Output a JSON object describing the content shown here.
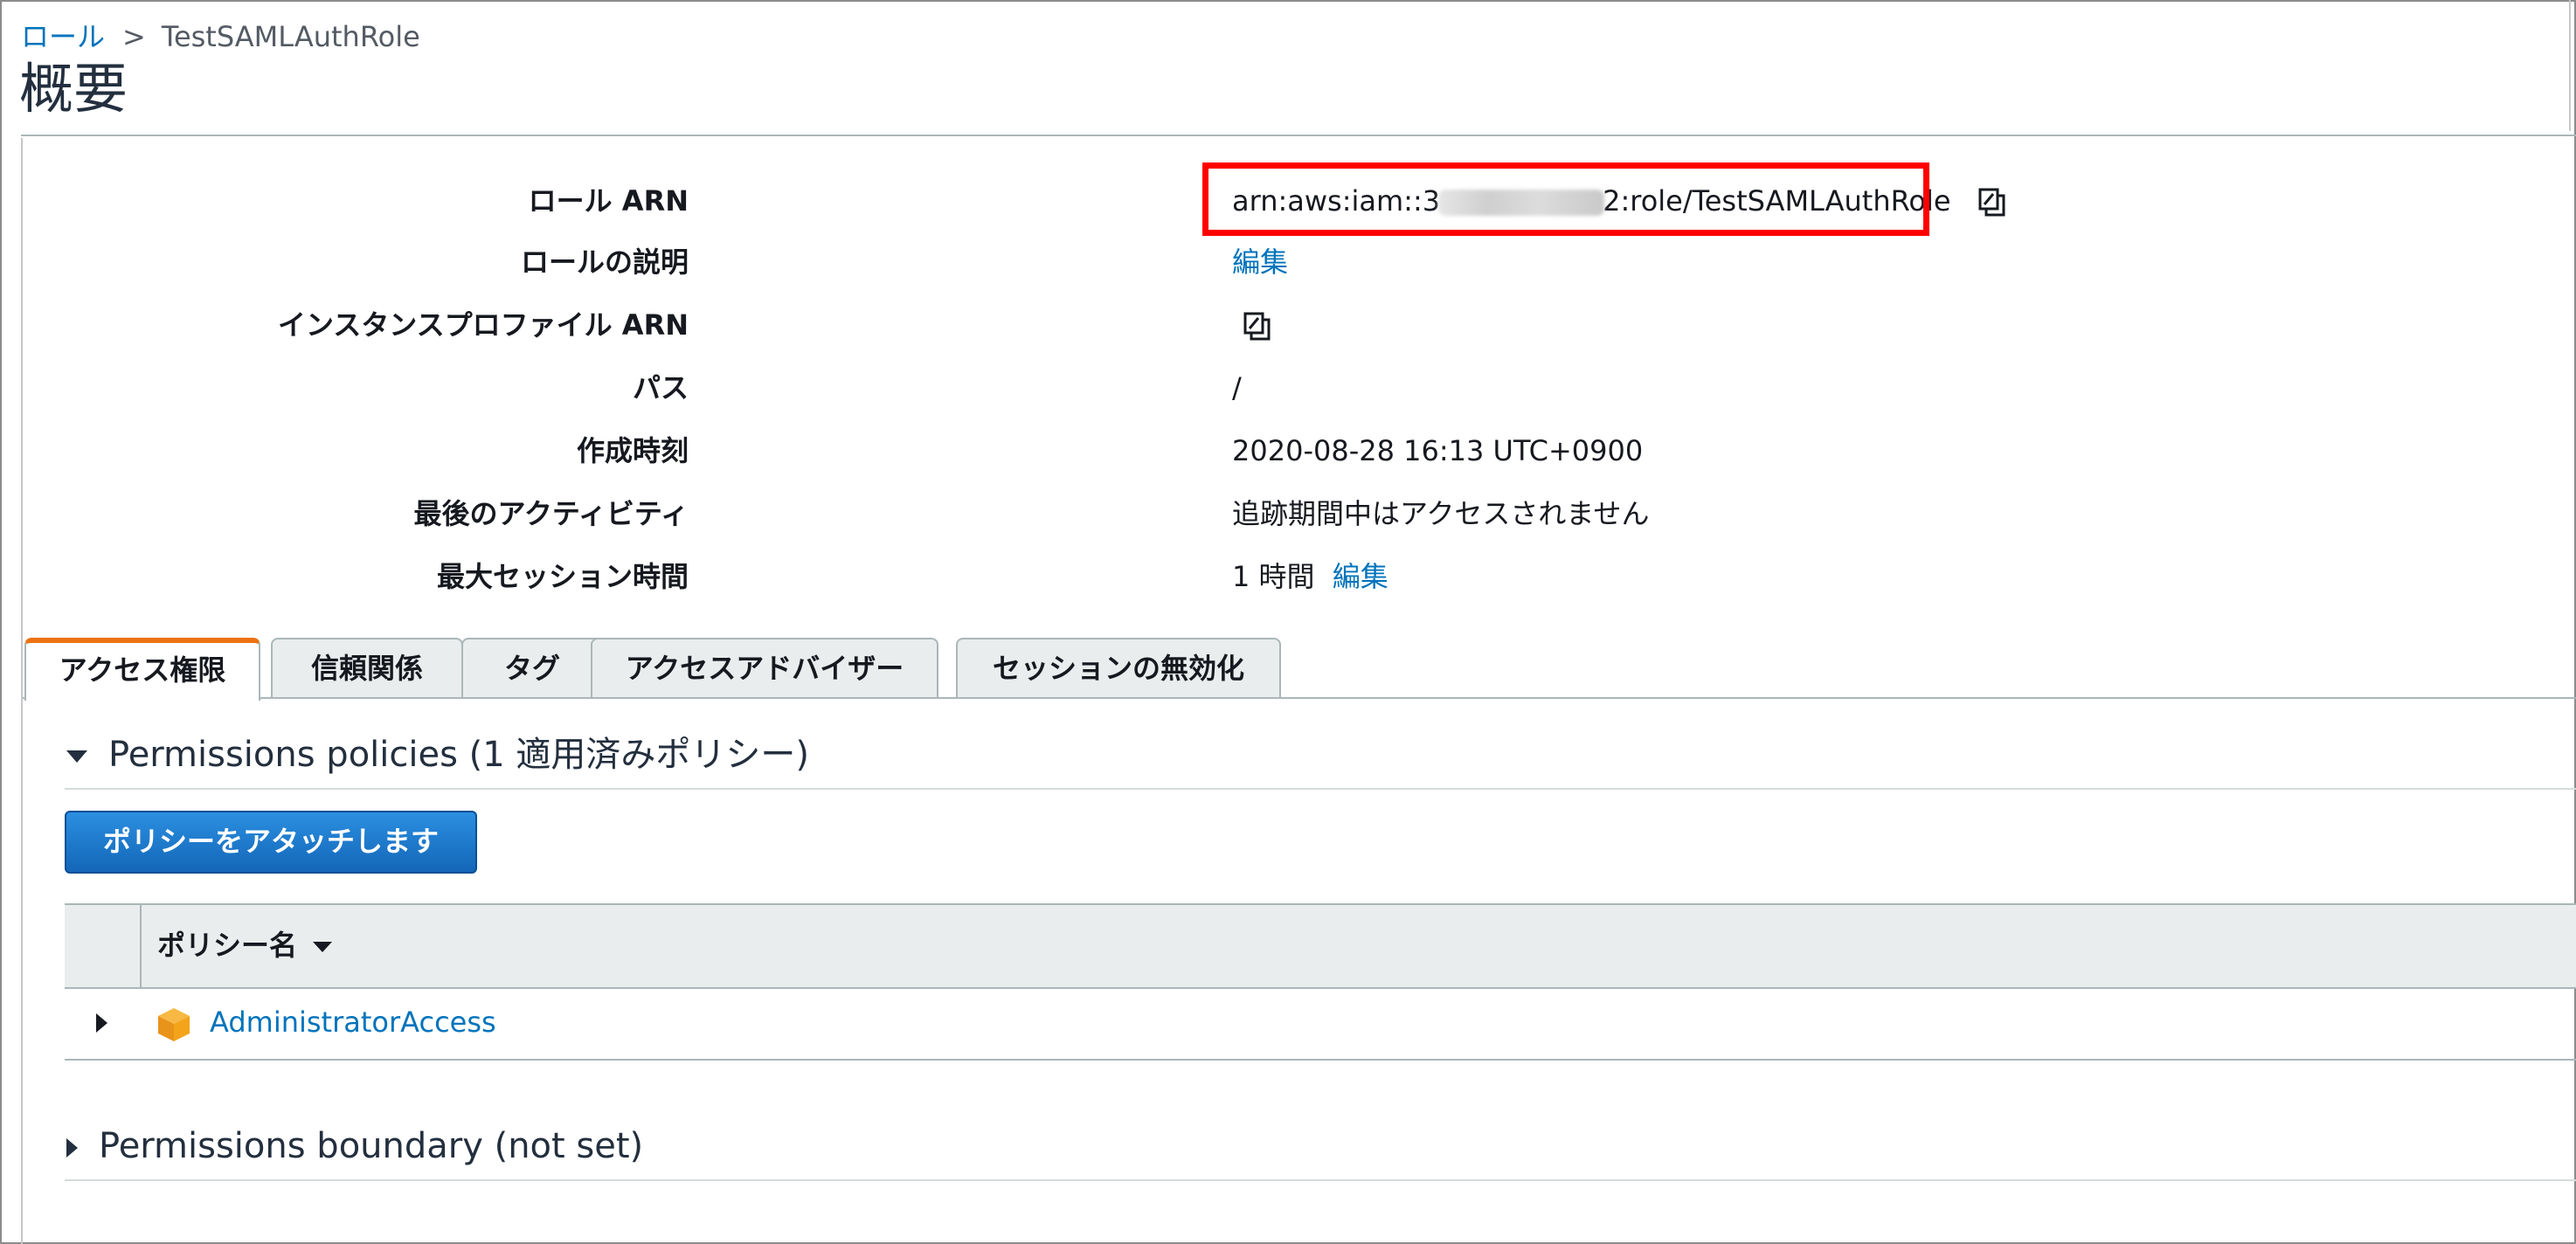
{
  "breadcrumb": {
    "parent": "ロール",
    "separator": ">",
    "current": "TestSAMLAuthRole"
  },
  "page": {
    "title": "概要"
  },
  "summary": {
    "role_arn": {
      "label": "ロール ARN",
      "value_prefix": "arn:aws:iam::3",
      "value_suffix": "2:role/TestSAMLAuthRole"
    },
    "role_description": {
      "label": "ロールの説明",
      "link": "編集"
    },
    "instance_profile_arn": {
      "label": "インスタンスプロファイル ARN"
    },
    "path": {
      "label": "パス",
      "value": "/"
    },
    "created": {
      "label": "作成時刻",
      "value": "2020-08-28 16:13 UTC+0900"
    },
    "last_activity": {
      "label": "最後のアクティビティ",
      "value": "追跡期間中はアクセスされません"
    },
    "max_session": {
      "label": "最大セッション時間",
      "value": "1 時間",
      "link": "編集"
    }
  },
  "tabs": [
    {
      "label": "アクセス権限",
      "active": true
    },
    {
      "label": "信頼関係",
      "active": false
    },
    {
      "label": "タグ",
      "active": false
    },
    {
      "label": "アクセスアドバイザー",
      "active": false
    },
    {
      "label": "セッションの無効化",
      "active": false
    }
  ],
  "permissions": {
    "heading": "Permissions policies (1 適用済みポリシー)",
    "attach_button": "ポリシーをアタッチします",
    "table": {
      "column_policy_name": "ポリシー名",
      "rows": [
        {
          "policy_name": "AdministratorAccess",
          "icon": "aws-managed-policy-cube-icon"
        }
      ]
    }
  },
  "boundary": {
    "heading": "Permissions boundary (not set)"
  },
  "colors": {
    "link": "#0073bb",
    "active_tab_accent": "#ec7211",
    "highlight_box": "#ff0000",
    "primary_button": "#1f77cc",
    "policy_icon": "#f3a41b"
  },
  "icons": {
    "copy": "copy-to-clipboard-icon",
    "expand": "caret-right-icon",
    "collapse": "caret-down-icon",
    "sort": "sort-down-icon"
  }
}
